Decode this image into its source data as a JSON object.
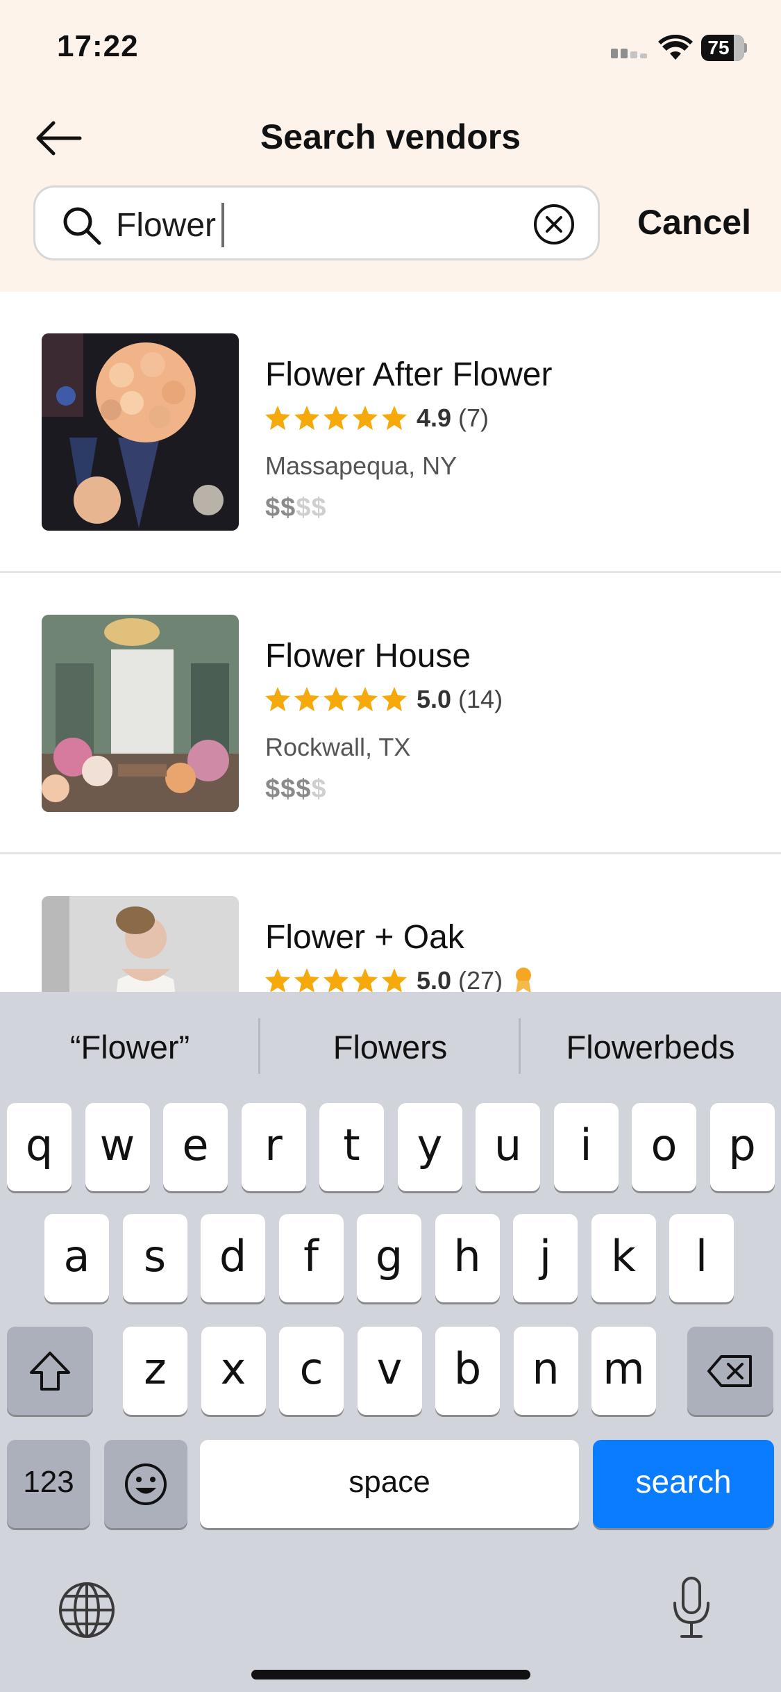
{
  "status_bar": {
    "time": "17:22",
    "battery": "75",
    "battery_level": 0.75
  },
  "header": {
    "title": "Search vendors",
    "back_icon": "arrow-left-icon",
    "search": {
      "value": "Flower",
      "placeholder": ""
    },
    "cancel_label": "Cancel"
  },
  "colors": {
    "header_bg": "#fdf3ea",
    "star": "#f5a90a",
    "accent_blue": "#0a7cff",
    "keyboard_bg": "#d1d4db"
  },
  "results": [
    {
      "name": "Flower After Flower",
      "rating": "4.9",
      "reviews": "(7)",
      "location": "Massapequa, NY",
      "price_on": "$$",
      "price_off": "$$",
      "award": false
    },
    {
      "name": "Flower House",
      "rating": "5.0",
      "reviews": "(14)",
      "location": "Rockwall, TX",
      "price_on": "$$$",
      "price_off": "$",
      "award": false
    },
    {
      "name": "Flower + Oak",
      "rating": "5.0",
      "reviews": "(27)",
      "location": "",
      "price_on": "",
      "price_off": "",
      "award": true
    }
  ],
  "keyboard": {
    "suggestions": [
      "“Flower”",
      "Flowers",
      "Flowerbeds"
    ],
    "row1": [
      "q",
      "w",
      "e",
      "r",
      "t",
      "y",
      "u",
      "i",
      "o",
      "p"
    ],
    "row2": [
      "a",
      "s",
      "d",
      "f",
      "g",
      "h",
      "j",
      "k",
      "l"
    ],
    "row3": [
      "z",
      "x",
      "c",
      "v",
      "b",
      "n",
      "m"
    ],
    "numbers_label": "123",
    "space_label": "space",
    "search_label": "search"
  }
}
